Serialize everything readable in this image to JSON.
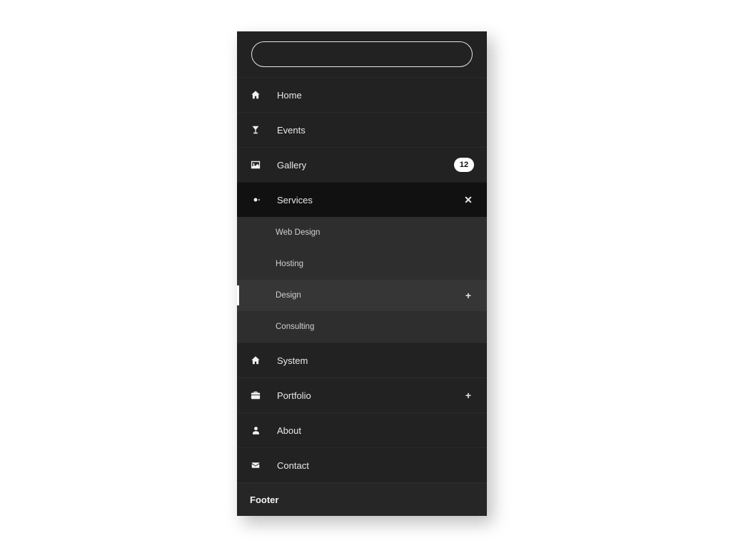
{
  "search": {
    "placeholder": ""
  },
  "menu": {
    "home": {
      "label": "Home"
    },
    "events": {
      "label": "Events"
    },
    "gallery": {
      "label": "Gallery",
      "badge": "12"
    },
    "services": {
      "label": "Services",
      "children": {
        "webdesign": {
          "label": "Web Design"
        },
        "hosting": {
          "label": "Hosting"
        },
        "design": {
          "label": "Design"
        },
        "consulting": {
          "label": "Consulting"
        }
      }
    },
    "system": {
      "label": "System"
    },
    "portfolio": {
      "label": "Portfolio"
    },
    "about": {
      "label": "About"
    },
    "contact": {
      "label": "Contact"
    }
  },
  "footer": {
    "label": "Footer"
  }
}
